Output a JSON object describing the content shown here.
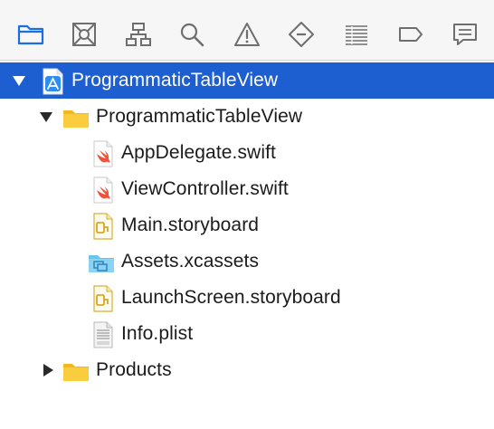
{
  "toolbar": {
    "buttons": [
      {
        "name": "project-navigator-icon",
        "active": true
      },
      {
        "name": "source-control-icon",
        "active": false
      },
      {
        "name": "symbol-navigator-icon",
        "active": false
      },
      {
        "name": "find-icon",
        "active": false
      },
      {
        "name": "issue-warning-icon",
        "active": false
      },
      {
        "name": "test-navigator-icon",
        "active": false
      },
      {
        "name": "debug-navigator-icon",
        "active": false
      },
      {
        "name": "breakpoint-icon",
        "active": false
      },
      {
        "name": "report-icon",
        "active": false
      }
    ],
    "active_color": "#1b6fe0",
    "inactive_color": "#6e6e6e"
  },
  "tree": {
    "project": {
      "label": "ProgrammaticTableView",
      "icon": "xcode-project-icon",
      "expanded": true,
      "selected": true
    },
    "group": {
      "label": "ProgrammaticTableView",
      "icon": "folder-icon",
      "expanded": true
    },
    "files": [
      {
        "label": "AppDelegate.swift",
        "icon": "swift-file-icon"
      },
      {
        "label": "ViewController.swift",
        "icon": "swift-file-icon"
      },
      {
        "label": "Main.storyboard",
        "icon": "storyboard-file-icon"
      },
      {
        "label": "Assets.xcassets",
        "icon": "asset-catalog-icon"
      },
      {
        "label": "LaunchScreen.storyboard",
        "icon": "storyboard-file-icon"
      },
      {
        "label": "Info.plist",
        "icon": "plist-file-icon"
      }
    ],
    "products": {
      "label": "Products",
      "icon": "folder-icon",
      "expanded": false
    }
  },
  "colors": {
    "selection": "#1d5fd1",
    "folder": "#f7c62f",
    "swift": "#f05138"
  }
}
